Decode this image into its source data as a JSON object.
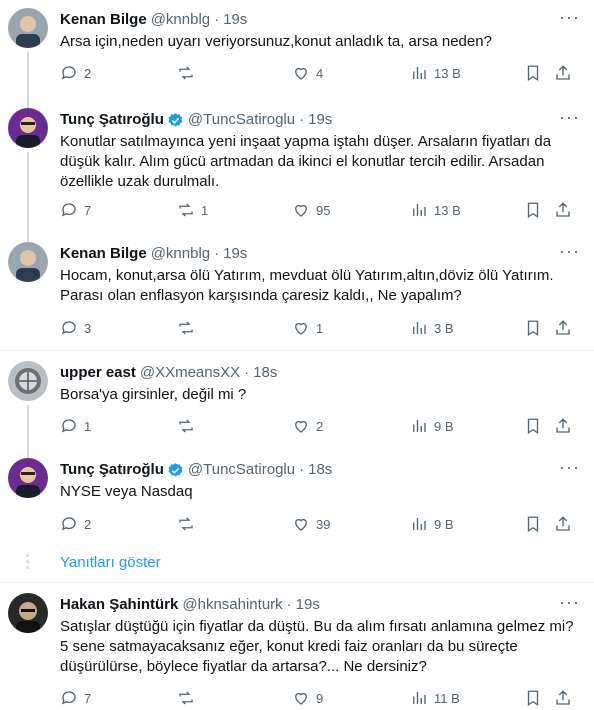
{
  "tweets": [
    {
      "name": "Kenan Bilge",
      "handle": "@knnblg",
      "time": "19s",
      "verified": false,
      "text": "Arsa için,neden uyarı veriyorsunuz,konut anladık ta, arsa neden?",
      "replies": "2",
      "reposts": "",
      "likes": "4",
      "views": "13 B"
    },
    {
      "name": "Tunç Şatıroğlu",
      "handle": "@TuncSatiroglu",
      "time": "19s",
      "verified": true,
      "text": "Konutlar satılmayınca yeni inşaat yapma iştahı düşer. Arsaların fiyatları da düşük kalır. Alım gücü artmadan da ikinci el konutlar tercih edilir. Arsadan özellikle uzak durulmalı.",
      "replies": "7",
      "reposts": "1",
      "likes": "95",
      "views": "13 B"
    },
    {
      "name": "Kenan Bilge",
      "handle": "@knnblg",
      "time": "19s",
      "verified": false,
      "text": "Hocam, konut,arsa ölü Yatırım, mevduat ölü Yatırım,altın,döviz ölü Yatırım. Parası olan enflasyon karşısında çaresiz kaldı,, Ne yapalım?",
      "replies": "3",
      "reposts": "",
      "likes": "1",
      "views": "3 B"
    },
    {
      "name": "upper east",
      "handle": "@XXmeansXX",
      "time": "18s",
      "verified": false,
      "text": "Borsa'ya girsinler, değil mi ?",
      "replies": "1",
      "reposts": "",
      "likes": "2",
      "views": "9 B"
    },
    {
      "name": "Tunç Şatıroğlu",
      "handle": "@TuncSatiroglu",
      "time": "18s",
      "verified": true,
      "text": "NYSE veya Nasdaq",
      "replies": "2",
      "reposts": "",
      "likes": "39",
      "views": "9 B"
    },
    {
      "name": "Hakan Şahintürk",
      "handle": "@hknsahinturk",
      "time": "19s",
      "verified": false,
      "text": "Satışlar düştüğü için fiyatlar da düştü. Bu da alım fırsatı anlamına gelmez mi? 5 sene satmayacaksanız eğer, konut kredi faiz oranları da bu süreçte düşürülürse, böylece fiyatlar da artarsa?... Ne dersiniz?",
      "replies": "7",
      "reposts": "",
      "likes": "9",
      "views": "11 B"
    }
  ],
  "show_replies_label": "Yanıtları göster",
  "icons": [
    "reply-icon",
    "repost-icon",
    "like-icon",
    "views-icon",
    "bookmark-icon",
    "share-icon",
    "verified-badge-icon",
    "more-icon"
  ],
  "colors": {
    "accent": "#1d9bf0",
    "muted": "#536471",
    "text": "#0f1419",
    "border": "#eff3f4"
  }
}
